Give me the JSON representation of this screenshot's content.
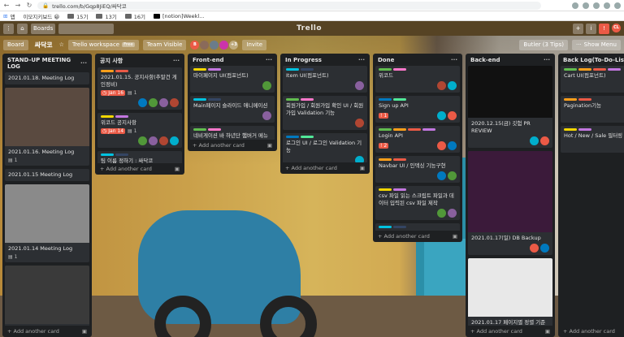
{
  "browser": {
    "url": "trello.com/b/Gqp8JiEQ/싸닥코"
  },
  "bookmarks": {
    "apps": "앱",
    "items": [
      "이모지키보드 😀",
      "15기",
      "13기",
      "16기",
      "[notion]Weekl..."
    ]
  },
  "header": {
    "boards": "Boards",
    "logo": "Trello",
    "avatar": "CL"
  },
  "boardbar": {
    "board": "Board",
    "name": "싸닥코",
    "workspace": "Trello workspace",
    "free": "Free",
    "visibility": "Team Visible",
    "more_count": "+3",
    "invite": "Invite",
    "butler": "Butler (3 Tips)",
    "show_menu": "Show Menu"
  },
  "colors": {
    "green": "#61bd4f",
    "yellow": "#f2d600",
    "orange": "#ff9f1a",
    "red": "#eb5a46",
    "purple": "#c377e0",
    "blue": "#0079bf",
    "sky": "#00c2e0",
    "lime": "#51e898",
    "pink": "#ff78cb",
    "navy": "#344563"
  },
  "lists": [
    {
      "title": "STAND-UP MEETING LOG",
      "cards": [
        {
          "t": "2021.01.18. Meeting Log"
        },
        {
          "thumb": "#5a4a40",
          "t": "2021.01.16. Meeting Log",
          "badges": "1"
        },
        {
          "t": "2021.01.15 Meeting Log"
        },
        {
          "thumb": "#8a8a8a",
          "t": "2021.01.14 Meeting Log",
          "badges": "1"
        },
        {
          "thumb": "#3a3a3a",
          "t": ""
        }
      ],
      "add": "Add another card"
    },
    {
      "title": "공지 사항",
      "cards": [
        {
          "t": "2021.01.15. 공지사항(추말건 게인정비)",
          "due": "Jan 16",
          "check": "1"
        },
        {
          "t": "위코드 공지사항",
          "due": "Jan 14",
          "check": "1"
        },
        {
          "t": "팀 이름 정하기 : 싸닥코",
          "check": "1"
        }
      ],
      "add": "Add another card"
    },
    {
      "title": "Front-end",
      "cards": [
        {
          "t": "마이페이지 UI(컴포넌트)"
        },
        {
          "t": "Main페이지 슬라이드 애니메이션"
        },
        {
          "t": "네비게이션 바 하년단 햄버거 메뉴 변경"
        },
        {
          "t": "검색바 컴포넌트 및 이벤트"
        }
      ],
      "add": "Add another card"
    },
    {
      "title": "In Progress",
      "cards": [
        {
          "t": "Item UI(컴포넌트)"
        },
        {
          "t": "회원가입 / 회원가입 확인 UI / 회원가입 Validation 기능"
        },
        {
          "t": "로그인 UI / 로그인 Validation 기능"
        }
      ],
      "add": "Add another card"
    },
    {
      "title": "Done",
      "cards": [
        {
          "t": "위코드"
        },
        {
          "t": "Sign up API",
          "att": "1"
        },
        {
          "t": "Login API",
          "att": "2"
        },
        {
          "t": "Navbar UI / 인덱싱 기능구현"
        },
        {
          "t": "csv 파일 읽는 스크립트 파일과 데이터 입력된 csv 파일 제작"
        },
        {
          "t": "Footer UI"
        }
      ],
      "add": "Add another card"
    },
    {
      "title": "Back-end",
      "cards": [
        {
          "thumb": "#111",
          "t": "2020.12.15(금) 깃험 PR REVIEW"
        },
        {
          "thumb": "#3b1a3a",
          "t": "2021.01.17(일) DB Backup"
        },
        {
          "thumb": "#e8e8e8",
          "t": "2021.01.17 페이지별 정렬 기준"
        }
      ],
      "add": "Add another card"
    },
    {
      "title": "Back Log(To-Do-List)",
      "cards": [
        {
          "t": "Cart UI(컴포넌트)"
        },
        {
          "t": "Pagination기능"
        },
        {
          "t": "Hot / New / Sale 필터링"
        }
      ],
      "add": "Add another card"
    }
  ]
}
